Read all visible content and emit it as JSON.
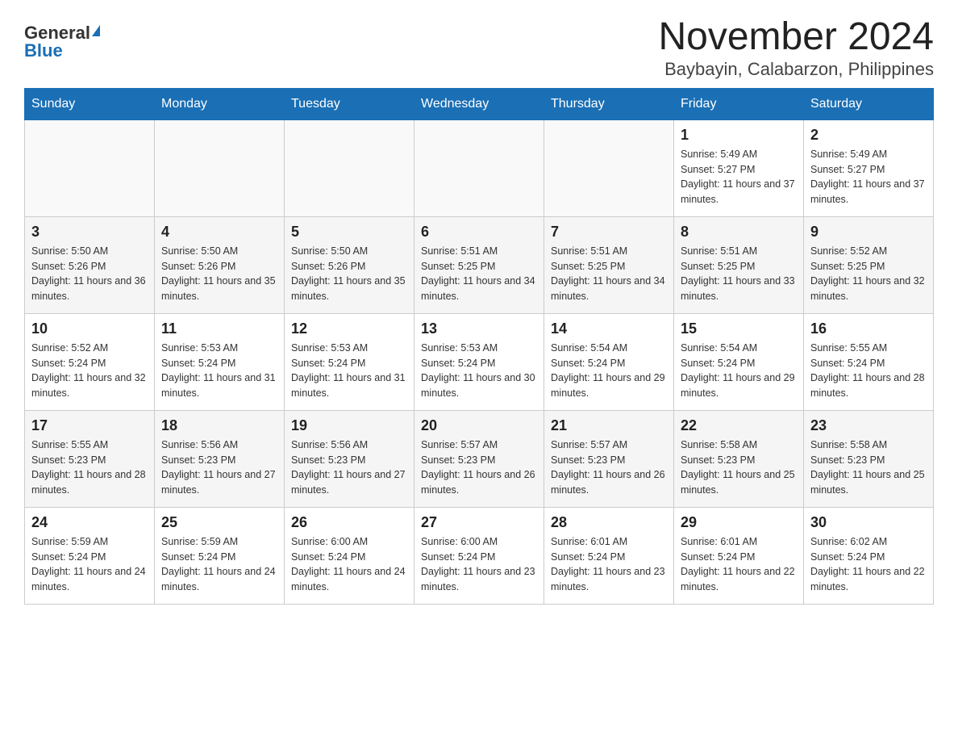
{
  "logo": {
    "general": "General",
    "blue": "Blue"
  },
  "title": "November 2024",
  "subtitle": "Baybayin, Calabarzon, Philippines",
  "days_of_week": [
    "Sunday",
    "Monday",
    "Tuesday",
    "Wednesday",
    "Thursday",
    "Friday",
    "Saturday"
  ],
  "weeks": [
    [
      {
        "day": "",
        "info": ""
      },
      {
        "day": "",
        "info": ""
      },
      {
        "day": "",
        "info": ""
      },
      {
        "day": "",
        "info": ""
      },
      {
        "day": "",
        "info": ""
      },
      {
        "day": "1",
        "info": "Sunrise: 5:49 AM\nSunset: 5:27 PM\nDaylight: 11 hours and 37 minutes."
      },
      {
        "day": "2",
        "info": "Sunrise: 5:49 AM\nSunset: 5:27 PM\nDaylight: 11 hours and 37 minutes."
      }
    ],
    [
      {
        "day": "3",
        "info": "Sunrise: 5:50 AM\nSunset: 5:26 PM\nDaylight: 11 hours and 36 minutes."
      },
      {
        "day": "4",
        "info": "Sunrise: 5:50 AM\nSunset: 5:26 PM\nDaylight: 11 hours and 35 minutes."
      },
      {
        "day": "5",
        "info": "Sunrise: 5:50 AM\nSunset: 5:26 PM\nDaylight: 11 hours and 35 minutes."
      },
      {
        "day": "6",
        "info": "Sunrise: 5:51 AM\nSunset: 5:25 PM\nDaylight: 11 hours and 34 minutes."
      },
      {
        "day": "7",
        "info": "Sunrise: 5:51 AM\nSunset: 5:25 PM\nDaylight: 11 hours and 34 minutes."
      },
      {
        "day": "8",
        "info": "Sunrise: 5:51 AM\nSunset: 5:25 PM\nDaylight: 11 hours and 33 minutes."
      },
      {
        "day": "9",
        "info": "Sunrise: 5:52 AM\nSunset: 5:25 PM\nDaylight: 11 hours and 32 minutes."
      }
    ],
    [
      {
        "day": "10",
        "info": "Sunrise: 5:52 AM\nSunset: 5:24 PM\nDaylight: 11 hours and 32 minutes."
      },
      {
        "day": "11",
        "info": "Sunrise: 5:53 AM\nSunset: 5:24 PM\nDaylight: 11 hours and 31 minutes."
      },
      {
        "day": "12",
        "info": "Sunrise: 5:53 AM\nSunset: 5:24 PM\nDaylight: 11 hours and 31 minutes."
      },
      {
        "day": "13",
        "info": "Sunrise: 5:53 AM\nSunset: 5:24 PM\nDaylight: 11 hours and 30 minutes."
      },
      {
        "day": "14",
        "info": "Sunrise: 5:54 AM\nSunset: 5:24 PM\nDaylight: 11 hours and 29 minutes."
      },
      {
        "day": "15",
        "info": "Sunrise: 5:54 AM\nSunset: 5:24 PM\nDaylight: 11 hours and 29 minutes."
      },
      {
        "day": "16",
        "info": "Sunrise: 5:55 AM\nSunset: 5:24 PM\nDaylight: 11 hours and 28 minutes."
      }
    ],
    [
      {
        "day": "17",
        "info": "Sunrise: 5:55 AM\nSunset: 5:23 PM\nDaylight: 11 hours and 28 minutes."
      },
      {
        "day": "18",
        "info": "Sunrise: 5:56 AM\nSunset: 5:23 PM\nDaylight: 11 hours and 27 minutes."
      },
      {
        "day": "19",
        "info": "Sunrise: 5:56 AM\nSunset: 5:23 PM\nDaylight: 11 hours and 27 minutes."
      },
      {
        "day": "20",
        "info": "Sunrise: 5:57 AM\nSunset: 5:23 PM\nDaylight: 11 hours and 26 minutes."
      },
      {
        "day": "21",
        "info": "Sunrise: 5:57 AM\nSunset: 5:23 PM\nDaylight: 11 hours and 26 minutes."
      },
      {
        "day": "22",
        "info": "Sunrise: 5:58 AM\nSunset: 5:23 PM\nDaylight: 11 hours and 25 minutes."
      },
      {
        "day": "23",
        "info": "Sunrise: 5:58 AM\nSunset: 5:23 PM\nDaylight: 11 hours and 25 minutes."
      }
    ],
    [
      {
        "day": "24",
        "info": "Sunrise: 5:59 AM\nSunset: 5:24 PM\nDaylight: 11 hours and 24 minutes."
      },
      {
        "day": "25",
        "info": "Sunrise: 5:59 AM\nSunset: 5:24 PM\nDaylight: 11 hours and 24 minutes."
      },
      {
        "day": "26",
        "info": "Sunrise: 6:00 AM\nSunset: 5:24 PM\nDaylight: 11 hours and 24 minutes."
      },
      {
        "day": "27",
        "info": "Sunrise: 6:00 AM\nSunset: 5:24 PM\nDaylight: 11 hours and 23 minutes."
      },
      {
        "day": "28",
        "info": "Sunrise: 6:01 AM\nSunset: 5:24 PM\nDaylight: 11 hours and 23 minutes."
      },
      {
        "day": "29",
        "info": "Sunrise: 6:01 AM\nSunset: 5:24 PM\nDaylight: 11 hours and 22 minutes."
      },
      {
        "day": "30",
        "info": "Sunrise: 6:02 AM\nSunset: 5:24 PM\nDaylight: 11 hours and 22 minutes."
      }
    ]
  ]
}
